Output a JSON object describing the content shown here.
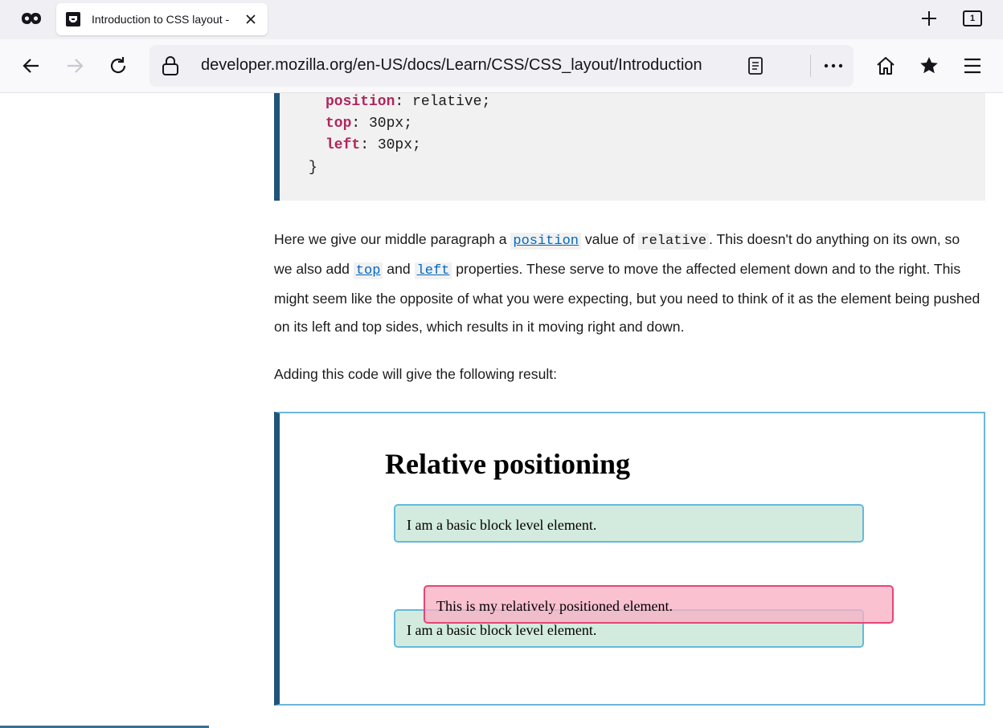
{
  "browser": {
    "tab": {
      "title": "Introduction to CSS layout - ",
      "count": "1"
    },
    "url": "developer.mozilla.org/en-US/docs/Learn/CSS/CSS_layout/Introduction"
  },
  "code_block": {
    "lines": [
      {
        "prop": "position",
        "value": ": relative;"
      },
      {
        "prop": "top",
        "value": ": 30px;"
      },
      {
        "prop": "left",
        "value": ": 30px;"
      }
    ],
    "closing": "}"
  },
  "paragraph1": {
    "t1": "Here we give our middle paragraph a ",
    "link_position": "position",
    "t2": " value of ",
    "code_relative": "relative",
    "t3": ". This doesn't do anything on its own, so we also add ",
    "link_top": "top",
    "t4": " and ",
    "link_left": "left",
    "t5": " properties. These serve to move the affected element down and to the right. This might seem like the opposite of what you were expecting, but you need to think of it as the element being pushed on its left and top sides, which results in it moving right and down."
  },
  "paragraph2": "Adding this code will give the following result:",
  "example": {
    "heading": "Relative positioning",
    "box1": "I am a basic block level element.",
    "box2": "This is my relatively positioned element.",
    "box3": "I am a basic block level element."
  }
}
